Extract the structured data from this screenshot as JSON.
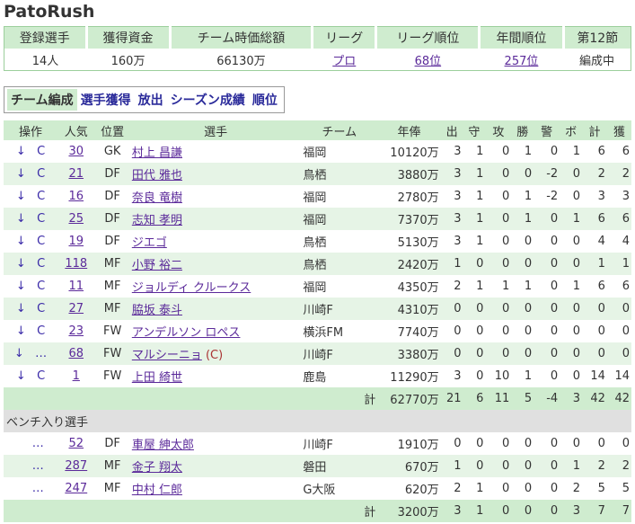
{
  "title": "PatoRush",
  "summary": {
    "headers": [
      "登録選手",
      "獲得資金",
      "チーム時価総額",
      "リーグ",
      "リーグ順位",
      "年間順位",
      "第12節"
    ],
    "values": [
      "14人",
      "160万",
      "66130万",
      "プロ",
      "68位",
      "257位",
      "編成中"
    ]
  },
  "tabs": [
    "チーム編成",
    "選手獲得",
    "放出",
    "シーズン成績",
    "順位"
  ],
  "table": {
    "headers": [
      "操作",
      "人気",
      "位置",
      "選手",
      "チーム",
      "年俸",
      "出",
      "守",
      "攻",
      "勝",
      "警",
      "ボ",
      "計",
      "獲"
    ],
    "starters": [
      {
        "op1": "↓",
        "op2": "C",
        "pop": "30",
        "pos": "GK",
        "name": "村上 昌謙",
        "cap": "",
        "team": "福岡",
        "salary": "10120万",
        "s": [
          "3",
          "1",
          "0",
          "1",
          "0",
          "1",
          "6",
          "6"
        ]
      },
      {
        "op1": "↓",
        "op2": "C",
        "pop": "21",
        "pos": "DF",
        "name": "田代 雅也",
        "cap": "",
        "team": "鳥栖",
        "salary": "3880万",
        "s": [
          "3",
          "1",
          "0",
          "0",
          "-2",
          "0",
          "2",
          "2"
        ]
      },
      {
        "op1": "↓",
        "op2": "C",
        "pop": "16",
        "pos": "DF",
        "name": "奈良 竜樹",
        "cap": "",
        "team": "福岡",
        "salary": "2780万",
        "s": [
          "3",
          "1",
          "0",
          "1",
          "-2",
          "0",
          "3",
          "3"
        ]
      },
      {
        "op1": "↓",
        "op2": "C",
        "pop": "25",
        "pos": "DF",
        "name": "志知 孝明",
        "cap": "",
        "team": "福岡",
        "salary": "7370万",
        "s": [
          "3",
          "1",
          "0",
          "1",
          "0",
          "1",
          "6",
          "6"
        ]
      },
      {
        "op1": "↓",
        "op2": "C",
        "pop": "19",
        "pos": "DF",
        "name": "ジエゴ",
        "cap": "",
        "team": "鳥栖",
        "salary": "5130万",
        "s": [
          "3",
          "1",
          "0",
          "0",
          "0",
          "0",
          "4",
          "4"
        ]
      },
      {
        "op1": "↓",
        "op2": "C",
        "pop": "118",
        "pos": "MF",
        "name": "小野 裕二",
        "cap": "",
        "team": "鳥栖",
        "salary": "2420万",
        "s": [
          "1",
          "0",
          "0",
          "0",
          "0",
          "0",
          "1",
          "1"
        ]
      },
      {
        "op1": "↓",
        "op2": "C",
        "pop": "11",
        "pos": "MF",
        "name": "ジョルディ クルークス",
        "cap": "",
        "team": "福岡",
        "salary": "4350万",
        "s": [
          "2",
          "1",
          "1",
          "1",
          "0",
          "1",
          "6",
          "6"
        ]
      },
      {
        "op1": "↓",
        "op2": "C",
        "pop": "27",
        "pos": "MF",
        "name": "脇坂 泰斗",
        "cap": "",
        "team": "川崎F",
        "salary": "4310万",
        "s": [
          "0",
          "0",
          "0",
          "0",
          "0",
          "0",
          "0",
          "0"
        ]
      },
      {
        "op1": "↓",
        "op2": "C",
        "pop": "23",
        "pos": "FW",
        "name": "アンデルソン ロペス",
        "cap": "",
        "team": "横浜FM",
        "salary": "7740万",
        "s": [
          "0",
          "0",
          "0",
          "0",
          "0",
          "0",
          "0",
          "0"
        ]
      },
      {
        "op1": "↓",
        "op2": "…",
        "pop": "68",
        "pos": "FW",
        "name": "マルシーニョ",
        "cap": "(C)",
        "team": "川崎F",
        "salary": "3380万",
        "s": [
          "0",
          "0",
          "0",
          "0",
          "0",
          "0",
          "0",
          "0"
        ]
      },
      {
        "op1": "↓",
        "op2": "C",
        "pop": "1",
        "pos": "FW",
        "name": "上田 綺世",
        "cap": "",
        "team": "鹿島",
        "salary": "11290万",
        "s": [
          "3",
          "0",
          "10",
          "1",
          "0",
          "0",
          "14",
          "14"
        ]
      }
    ],
    "starters_total": {
      "label": "計",
      "salary": "62770万",
      "s": [
        "21",
        "6",
        "11",
        "5",
        "-4",
        "3",
        "42",
        "42"
      ]
    },
    "bench_label": "ベンチ入り選手",
    "bench": [
      {
        "op1": "",
        "op2": "…",
        "pop": "52",
        "pos": "DF",
        "name": "車屋 紳太郎",
        "cap": "",
        "team": "川崎F",
        "salary": "1910万",
        "s": [
          "0",
          "0",
          "0",
          "0",
          "0",
          "0",
          "0",
          "0"
        ]
      },
      {
        "op1": "",
        "op2": "…",
        "pop": "287",
        "pos": "MF",
        "name": "金子 翔太",
        "cap": "",
        "team": "磐田",
        "salary": "670万",
        "s": [
          "1",
          "0",
          "0",
          "0",
          "0",
          "1",
          "2",
          "2"
        ]
      },
      {
        "op1": "",
        "op2": "…",
        "pop": "247",
        "pos": "MF",
        "name": "中村 仁郎",
        "cap": "",
        "team": "G大阪",
        "salary": "620万",
        "s": [
          "2",
          "1",
          "0",
          "0",
          "0",
          "2",
          "5",
          "5"
        ]
      }
    ],
    "bench_total": {
      "label": "計",
      "salary": "3200万",
      "s": [
        "3",
        "1",
        "0",
        "0",
        "0",
        "3",
        "7",
        "7"
      ]
    }
  }
}
